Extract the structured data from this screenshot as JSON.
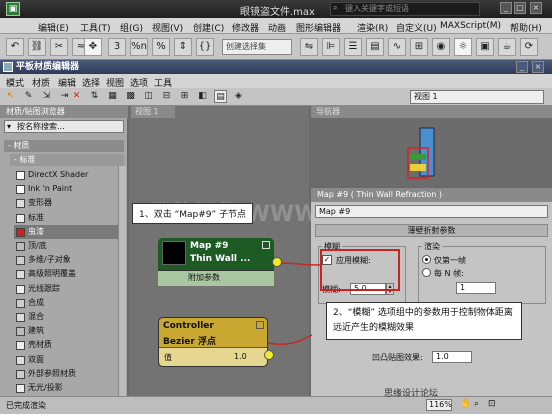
{
  "app": {
    "title": "眼镜盗文件.max",
    "search_placeholder": "键入关键字或短语"
  },
  "main_menu": [
    "编辑(E)",
    "工具(T)",
    "组(G)",
    "视图(V)",
    "创建(C)",
    "修改器",
    "动画",
    "图形编辑器",
    "渲染(R)",
    "自定义(U)",
    "MAXScript(M)",
    "帮助(H)"
  ],
  "main_toolbar": {
    "selection_set_placeholder": "创建选择集",
    "snap_label": "3",
    "angle_label": "%n",
    "percent_label": "%"
  },
  "slate": {
    "title": "平板材质编辑器",
    "menu": [
      "模式",
      "材质",
      "编辑",
      "选择",
      "视图",
      "选项",
      "工具"
    ],
    "view_dropdown": "视图 1"
  },
  "browser": {
    "title": "材质/贴图浏览器",
    "search_placeholder": "按名称搜索...",
    "category": "- 材质",
    "subcategory": "- 标准",
    "items": [
      "DirectX Shader",
      "Ink 'n Paint",
      "变形器",
      "标准",
      "虫漆",
      "顶/底",
      "多维/子对象",
      "高级照明覆盖",
      "光线跟踪",
      "合成",
      "混合",
      "建筑",
      "壳材质",
      "双面",
      "外部参照材质",
      "无光/投影"
    ],
    "selected_index": 4
  },
  "view": {
    "tab_label": "视图 1"
  },
  "nav": {
    "title": "导航器"
  },
  "params": {
    "title": "Map #9  ( Thin Wall Refraction )",
    "material_name": "Map #9",
    "rollout_title": "薄壁折射参数",
    "blur_group_label": "模糊",
    "apply_blur_label": "应用模糊:",
    "apply_blur_checked": true,
    "blur_label": "模糊:",
    "blur_value": "5.0",
    "render_group_label": "渲染",
    "first_frame_only_label": "仅第一帧",
    "every_n_frames_label": "每 N 帧:",
    "n_value": "1",
    "bump_label": "凹凸贴图效果:",
    "bump_value": "1.0"
  },
  "nodes": {
    "map": {
      "name": "Map #9",
      "type": "Thin Wall ...",
      "sub": "附加参数"
    },
    "controller": {
      "name": "Controller",
      "type": "Bezier 浮点",
      "value_label": "值",
      "value": "1.0"
    }
  },
  "callouts": {
    "one": "1、双击 “Map#9” 子节点",
    "two": "2、“模糊” 选项组中的参数用于控制物体距离远近产生的模糊效果"
  },
  "watermark": "腾龍視覺 WWW.TLV1.NET",
  "watermark2": "思缘设计论坛",
  "status": {
    "text": "已完成渲染",
    "zoom": "116%"
  },
  "colors": {
    "callout_border": "#cc2222",
    "node_map": "#1e5a24",
    "node_ctrl": "#c8a830"
  }
}
